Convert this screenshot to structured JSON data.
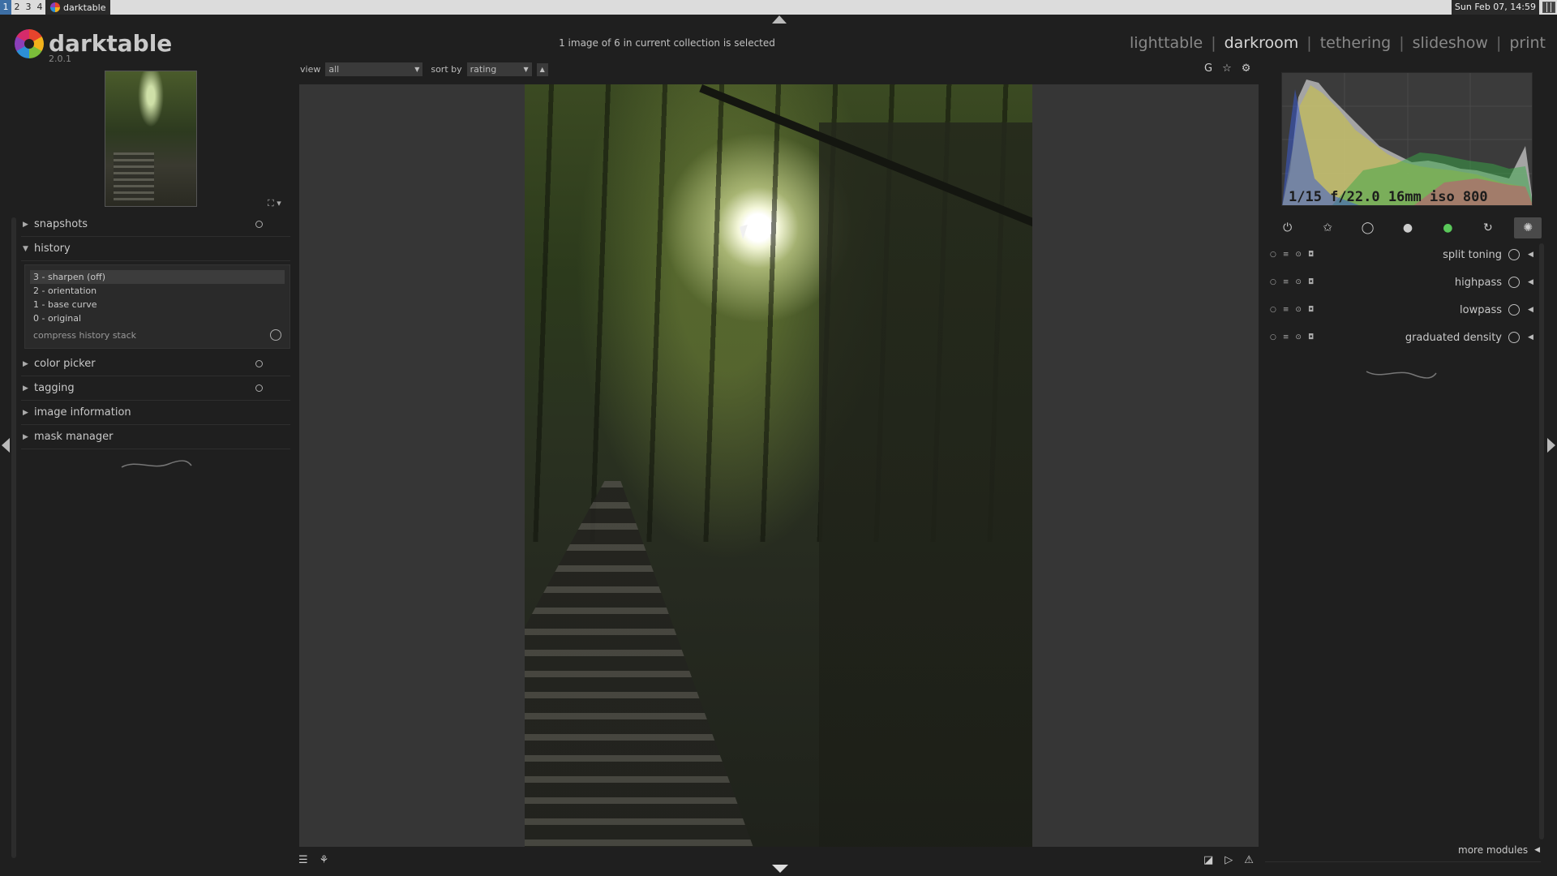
{
  "taskbar": {
    "workspaces": [
      "1",
      "2",
      "3",
      "4"
    ],
    "app_title": "darktable",
    "clock": "Sun Feb 07, 14:59"
  },
  "header": {
    "app_name": "darktable",
    "version": "2.0.1",
    "collection_info": "1 image of 6 in current collection is selected",
    "views": [
      "lighttable",
      "darkroom",
      "tethering",
      "slideshow",
      "print"
    ],
    "active_view": "darkroom",
    "separator": "|"
  },
  "filter": {
    "view_label": "view",
    "view_value": "all",
    "sort_label": "sort by",
    "sort_value": "rating"
  },
  "top_icons": [
    "G",
    "☆",
    "⚙"
  ],
  "left_panel": {
    "sections": [
      {
        "label": "snapshots",
        "expanded": false
      },
      {
        "label": "history",
        "expanded": true
      },
      {
        "label": "color picker",
        "expanded": false
      },
      {
        "label": "tagging",
        "expanded": false
      },
      {
        "label": "image information",
        "expanded": false
      },
      {
        "label": "mask manager",
        "expanded": false
      }
    ],
    "history_items": [
      "3 - sharpen (off)",
      "2 - orientation",
      "1 - base curve",
      "0 - original"
    ],
    "selected_history": 0,
    "compress_label": "compress history stack"
  },
  "histogram": {
    "exif": "1/15 f/22.0 16mm iso 800"
  },
  "module_groups": [
    "power-icon",
    "favorite-icon",
    "basic-icon",
    "tone-icon",
    "color-icon",
    "correct-icon",
    "effect-icon"
  ],
  "modules": [
    {
      "name": "split toning"
    },
    {
      "name": "highpass"
    },
    {
      "name": "lowpass"
    },
    {
      "name": "graduated density"
    }
  ],
  "more_modules": "more modules",
  "colors": {
    "background": "#1f1f1f",
    "panel_text": "#c8c8c8",
    "center_bg": "#363636"
  }
}
